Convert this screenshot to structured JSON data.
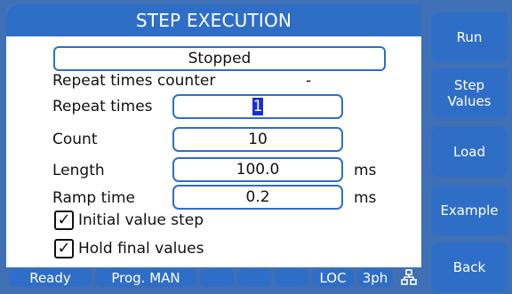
{
  "title": "STEP EXECUTION",
  "status": "Stopped",
  "repeat_counter": {
    "label": "Repeat times counter",
    "value": "-"
  },
  "repeat_times": {
    "label": "Repeat times",
    "value": "1"
  },
  "count": {
    "label": "Count",
    "value": "10"
  },
  "length": {
    "label": "Length",
    "value": "100.0",
    "unit": "ms"
  },
  "ramp_time": {
    "label": "Ramp time",
    "value": "0.2",
    "unit": "ms"
  },
  "checkboxes": {
    "initial_value_step": {
      "label": "Initial value step",
      "checked": true,
      "mark": "✓"
    },
    "hold_final_values": {
      "label": "Hold final values",
      "checked": true,
      "mark": "✓"
    }
  },
  "statusbar": {
    "ready": "Ready",
    "prog": "Prog. MAN",
    "loc": "LOC",
    "phase": "3ph",
    "network_icon": "network-icon"
  },
  "side_buttons": [
    "Run",
    "Step Values",
    "Load",
    "Example",
    "Back"
  ],
  "colors": {
    "accent": "#2f6ec6",
    "background": "#3f6fb4",
    "selection": "#1a2fd0"
  }
}
